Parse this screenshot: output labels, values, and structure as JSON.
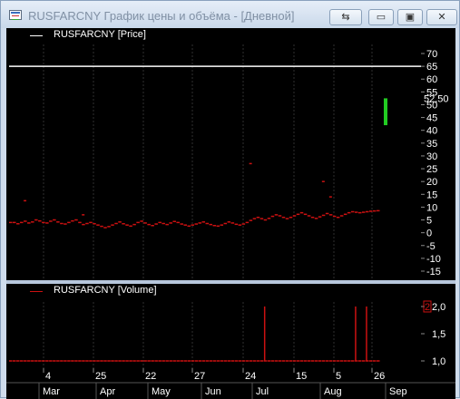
{
  "window": {
    "title": "RUSFARCNY График цены и объёма - [Дневной]",
    "restore_glyph": "⇆",
    "min_glyph": "▭",
    "max_glyph": "▣",
    "close_glyph": "✕"
  },
  "price_pane": {
    "legend": "RUSFARCNY [Price]",
    "legend_color": "#ffffff",
    "last_value_label": "52,50",
    "y_ticks": [
      "70",
      "65",
      "60",
      "55",
      "50",
      "45",
      "40",
      "35",
      "30",
      "25",
      "20",
      "15",
      "10",
      "5",
      "0",
      "-5",
      "-10",
      "-15"
    ],
    "hline_value": 65,
    "hline_color": "#ffffff",
    "signal_bar_color": "#22cc22",
    "series_color": "#cc1111",
    "grid_color": "#303030"
  },
  "volume_pane": {
    "legend": "RUSFARCNY [Volume]",
    "legend_color": "#cc1111",
    "y_ticks": [
      "2,0",
      "1,5",
      "1,0"
    ],
    "top_marker": "2"
  },
  "x_axis": {
    "day_labels": [
      "4",
      "25",
      "22",
      "27",
      "24",
      "15",
      "5",
      "26"
    ],
    "month_labels": [
      "Mar",
      "Apr",
      "May",
      "Jun",
      "Jul",
      "Aug",
      "Sep"
    ]
  },
  "chart_data": {
    "type": "line",
    "price_series": {
      "name": "RUSFARCNY [Price]",
      "values": [
        4,
        4,
        3.5,
        4,
        4.5,
        3.8,
        4.2,
        5,
        4.6,
        4,
        3.8,
        4.5,
        5,
        4.2,
        3.6,
        3.4,
        4,
        4.6,
        5,
        4,
        3.2,
        3.6,
        4,
        3.5,
        3,
        2.5,
        2,
        2.4,
        3,
        3.6,
        4.2,
        3.5,
        3,
        2.6,
        3.2,
        4,
        4.5,
        3.8,
        3.2,
        2.8,
        3.4,
        4,
        3.6,
        3.2,
        3.8,
        4.4,
        4,
        3.4,
        3,
        2.6,
        3,
        3.4,
        3.8,
        4.2,
        3.6,
        3.2,
        2.8,
        2.6,
        3,
        3.6,
        4.2,
        3.8,
        3.3,
        3,
        3.4,
        4,
        4.8,
        5.5,
        6,
        5.5,
        5,
        5.6,
        6.4,
        7,
        6.6,
        6,
        5.5,
        6,
        6.6,
        7.2,
        7.8,
        7.2,
        6.6,
        6,
        5.6,
        6.2,
        6.8,
        7.5,
        7,
        6.4,
        6,
        6.6,
        7.2,
        7.8,
        8.2,
        8,
        7.8,
        8,
        8.2,
        8.4,
        8.5,
        8.6
      ],
      "outliers": [
        {
          "index": 4,
          "value": 12.5
        },
        {
          "index": 20,
          "value": 7
        },
        {
          "index": 66,
          "value": 27
        },
        {
          "index": 86,
          "value": 20
        },
        {
          "index": 88,
          "value": 14
        }
      ],
      "ylim": [
        -15,
        70
      ]
    },
    "volume_series": {
      "name": "RUSFARCNY [Volume]",
      "baseline": 1.0,
      "spikes": [
        {
          "index": 70,
          "value": 2.0
        },
        {
          "index": 95,
          "value": 2.0
        },
        {
          "index": 98,
          "value": 2.0
        }
      ],
      "ylim": [
        1.0,
        2.0
      ]
    }
  }
}
